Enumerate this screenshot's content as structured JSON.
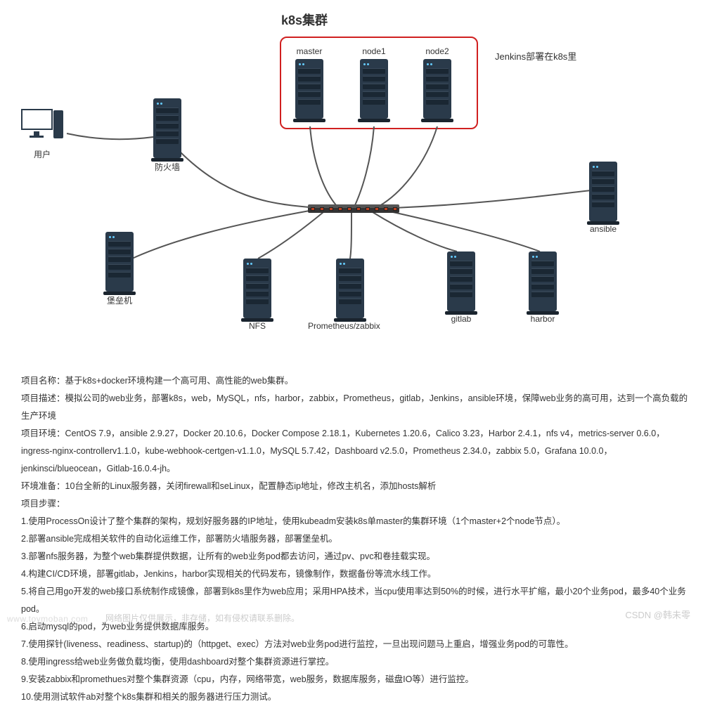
{
  "diagram": {
    "title": "k8s集群",
    "side_label": "Jenkins部署在k8s里",
    "nodes": {
      "user": {
        "label": "用户"
      },
      "firewall": {
        "label": "防火墙"
      },
      "master": {
        "label": "master"
      },
      "node1": {
        "label": "node1"
      },
      "node2": {
        "label": "node2"
      },
      "bastion": {
        "label": "堡垒机"
      },
      "nfs": {
        "label": "NFS"
      },
      "promzbx": {
        "label": "Prometheus/zabbix"
      },
      "gitlab": {
        "label": "gitlab"
      },
      "harbor": {
        "label": "harbor"
      },
      "ansible": {
        "label": "ansible"
      }
    }
  },
  "text": {
    "proj_name": "项目名称：基于k8s+docker环境构建一个高可用、高性能的web集群。",
    "proj_desc": "项目描述：模拟公司的web业务，部署k8s，web，MySQL，nfs，harbor，zabbix，Prometheus，gitlab，Jenkins，ansible环境，保障web业务的高可用，达到一个高负载的生产环境",
    "proj_env": "项目环境：CentOS 7.9，ansible 2.9.27，Docker 20.10.6，Docker Compose 2.18.1，Kubernetes 1.20.6，Calico 3.23，Harbor 2.4.1，nfs v4，metrics-server 0.6.0，ingress-nginx-controllerv1.1.0，kube-webhook-certgen-v1.1.0，MySQL 5.7.42，Dashboard v2.5.0，Prometheus 2.34.0，zabbix 5.0，Grafana 10.0.0，jenkinsci/blueocean，Gitlab-16.0.4-jh。",
    "env_prep": "环境准备：10台全新的Linux服务器，关闭firewall和seLinux，配置静态ip地址，修改主机名，添加hosts解析",
    "steps_hdr": "项目步骤：",
    "step1": "1.使用ProcessOn设计了整个集群的架构，规划好服务器的IP地址，使用kubeadm安装k8s单master的集群环境（1个master+2个node节点）。",
    "step2": "2.部署ansible完成相关软件的自动化运维工作，部署防火墙服务器，部署堡垒机。",
    "step3": "3.部署nfs服务器，为整个web集群提供数据，让所有的web业务pod都去访问，通过pv、pvc和卷挂载实现。",
    "step4": "4.构建CI/CD环境，部署gitlab，Jenkins，harbor实现相关的代码发布，镜像制作，数据备份等流水线工作。",
    "step5": "5.将自己用go开发的web接口系统制作成镜像，部署到k8s里作为web应用；采用HPA技术，当cpu使用率达到50%的时候，进行水平扩缩，最小20个业务pod，最多40个业务pod。",
    "step6": "6.启动mysql的pod，为web业务提供数据库服务。",
    "step7": "7.使用探针(liveness、readiness、startup)的（httpget、exec）方法对web业务pod进行监控，一旦出现问题马上重启，增强业务pod的可靠性。",
    "step8": "8.使用ingress给web业务做负载均衡，使用dashboard对整个集群资源进行掌控。",
    "step9": "9.安装zabbix和promethues对整个集群资源（cpu，内存，网络带宽，web服务，数据库服务，磁盘IO等）进行监控。",
    "step10": "10.使用测试软件ab对整个k8s集群和相关的服务器进行压力测试。"
  },
  "watermark": {
    "left": "www.toymoban.com",
    "center": "网络图片仅供展示，非存储，如有侵权请联系删除。",
    "right": "CSDN @韩未零"
  }
}
